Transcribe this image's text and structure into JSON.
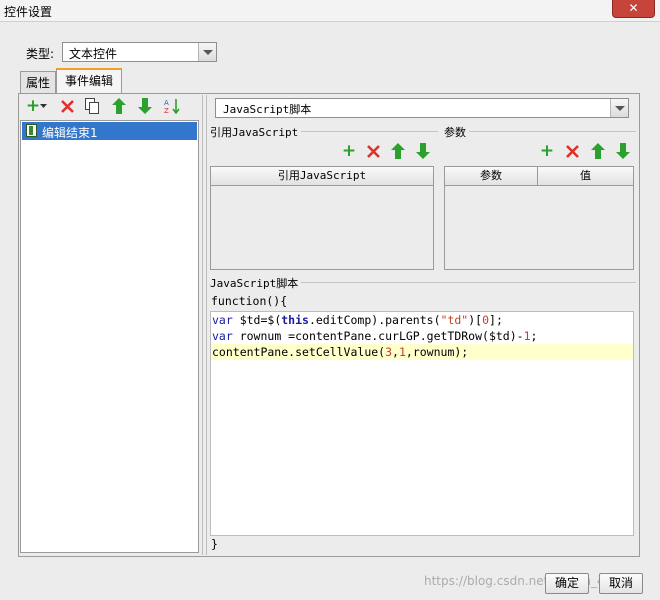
{
  "window": {
    "title": "控件设置",
    "close_glyph": "✕"
  },
  "type_field": {
    "label": "类型:",
    "value": "文本控件"
  },
  "tabs": [
    {
      "label": "属性"
    },
    {
      "label": "事件编辑"
    }
  ],
  "events": {
    "items": [
      {
        "label": "编辑结束1"
      }
    ]
  },
  "script_type": {
    "value": "JavaScript脚本"
  },
  "ref_js": {
    "group_title": "引用JavaScript",
    "column": "引用JavaScript"
  },
  "params": {
    "group_title": "参数",
    "columns": [
      "参数",
      "值"
    ]
  },
  "script": {
    "group_title": "JavaScript脚本",
    "header": "function(){",
    "footer": "}",
    "lines": [
      "var $td=$(this.editComp).parents(\"td\")[0];",
      "var rownum =contentPane.curLGP.getTDRow($td)-1;",
      "contentPane.setCellValue(3,1,rownum);"
    ],
    "highlighted_line": 3,
    "highlight_color": "#ffffcc"
  },
  "footer": {
    "ok": "确定",
    "cancel": "取消",
    "watermark": "https://blog.csdn.net/weixin_4"
  },
  "colors": {
    "add": "#2ca02c",
    "delete": "#e0302a",
    "selection": "#3377cc",
    "active_tab_accent": "#f0a028"
  }
}
